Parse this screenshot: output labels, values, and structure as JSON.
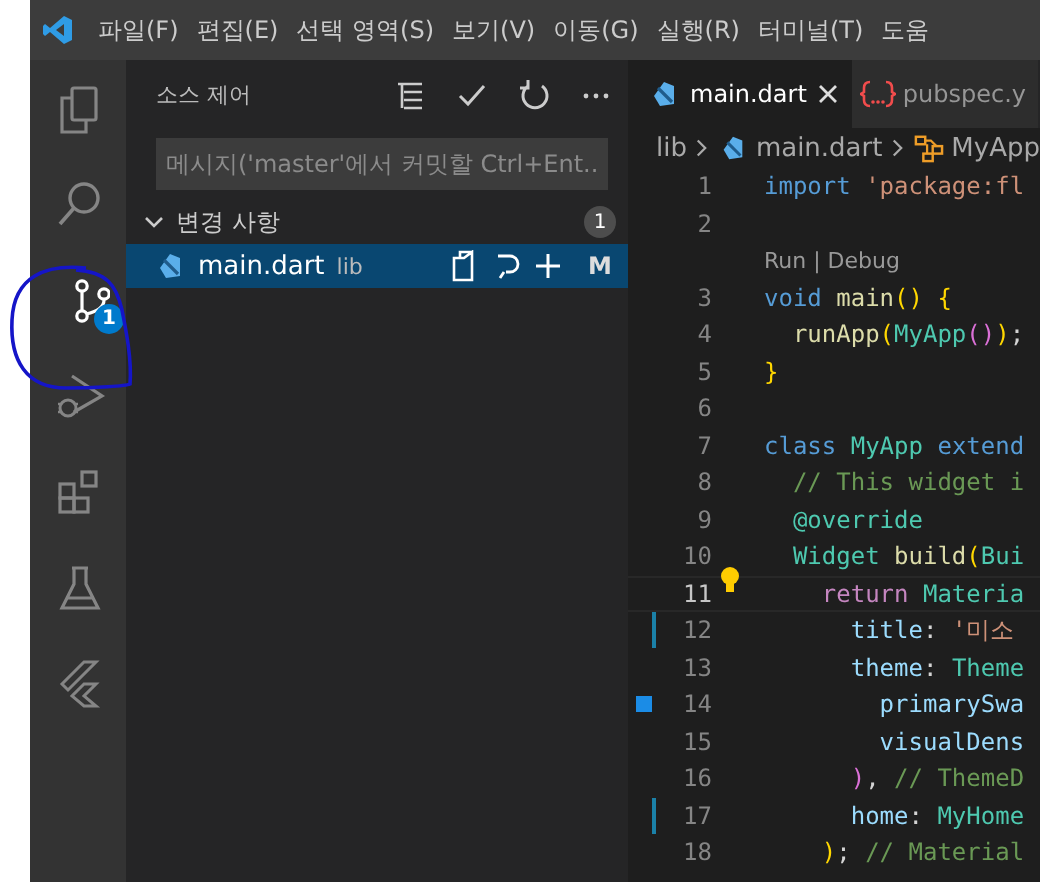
{
  "menu_bar": {
    "items": [
      "파일(F)",
      "편집(E)",
      "선택 영역(S)",
      "보기(V)",
      "이동(G)",
      "실행(R)",
      "터미널(T)",
      "도움"
    ]
  },
  "activity_bar": [
    {
      "kind": "explorer",
      "selected": false
    },
    {
      "kind": "search",
      "selected": false
    },
    {
      "kind": "source-control",
      "selected": true,
      "badge": "1"
    },
    {
      "kind": "run",
      "selected": false
    },
    {
      "kind": "extensions",
      "selected": false
    },
    {
      "kind": "testing",
      "selected": false
    },
    {
      "kind": "flutter",
      "selected": false
    }
  ],
  "annotation": {
    "kind": "circle"
  },
  "sidebar": {
    "title": "소스 제어",
    "commit_input": {
      "placeholder": "메시지('master'에서 커밋할 Ctrl+Ent..."
    },
    "section": {
      "title": "변경 사항",
      "expanded": true,
      "count": "1"
    },
    "files": [
      {
        "name": "main.dart",
        "folder": "lib",
        "status": "M",
        "selected": true
      }
    ]
  },
  "tabs": [
    {
      "label": "main.dart",
      "kind": "dart",
      "selected": true
    },
    {
      "label": "pubspec.y",
      "kind": "yaml",
      "selected": false
    }
  ],
  "breadcrumb": [
    {
      "kind": "folder",
      "text": "lib"
    },
    {
      "kind": "dart",
      "text": "main.dart"
    },
    {
      "kind": "class",
      "text": "MyApp"
    }
  ],
  "code": [
    {
      "number": "1",
      "current": false,
      "modified": false,
      "marker": false,
      "tokens": [
        {
          "kind": "kw",
          "text": "import "
        },
        {
          "kind": "str",
          "text": "'package:fl"
        }
      ]
    },
    {
      "number": "2",
      "current": false,
      "modified": false,
      "marker": false
    },
    {
      "kind": "codelens",
      "text": "Run | Debug"
    },
    {
      "number": "3",
      "current": false,
      "modified": false,
      "marker": false,
      "tokens": [
        {
          "kind": "kw",
          "text": "void "
        },
        {
          "kind": "fn",
          "text": "main"
        },
        {
          "kind": "br",
          "text": "() {"
        }
      ]
    },
    {
      "number": "4",
      "current": false,
      "modified": false,
      "marker": false,
      "tokens": [
        {
          "kind": "fn",
          "text": "  runApp"
        },
        {
          "kind": "br",
          "text": "("
        },
        {
          "kind": "ty",
          "text": "MyApp"
        },
        {
          "kind": "br2",
          "text": "()"
        },
        {
          "kind": "br",
          "text": ")"
        },
        {
          "kind": "pl",
          "text": ";"
        }
      ]
    },
    {
      "number": "5",
      "current": false,
      "modified": false,
      "marker": false,
      "tokens": [
        {
          "kind": "br",
          "text": "}"
        }
      ]
    },
    {
      "number": "6",
      "current": false,
      "modified": false,
      "marker": false
    },
    {
      "number": "7",
      "current": false,
      "modified": false,
      "marker": false,
      "tokens": [
        {
          "kind": "kw",
          "text": "class "
        },
        {
          "kind": "ty",
          "text": "MyApp "
        },
        {
          "kind": "kw",
          "text": "extend"
        }
      ]
    },
    {
      "number": "8",
      "current": false,
      "modified": false,
      "marker": false,
      "tokens": [
        {
          "kind": "cm",
          "text": "  // This widget i"
        }
      ]
    },
    {
      "number": "9",
      "current": false,
      "modified": false,
      "marker": false,
      "tokens": [
        {
          "kind": "ty",
          "text": "  @override"
        }
      ]
    },
    {
      "number": "10",
      "current": false,
      "modified": false,
      "marker": false,
      "tokens": [
        {
          "kind": "ty",
          "text": "  Widget "
        },
        {
          "kind": "fn",
          "text": "build"
        },
        {
          "kind": "br",
          "text": "("
        },
        {
          "kind": "ty",
          "text": "Bui"
        }
      ]
    },
    {
      "number": "11",
      "current": true,
      "modified": false,
      "marker": false,
      "tokens": [
        {
          "kind": "ctl",
          "text": "    return "
        },
        {
          "kind": "ty",
          "text": "Materia"
        }
      ]
    },
    {
      "number": "12",
      "current": false,
      "modified": true,
      "marker": false,
      "tokens": [
        {
          "kind": "vr",
          "text": "      title"
        },
        {
          "kind": "pl",
          "text": ": "
        },
        {
          "kind": "str",
          "text": "'미소"
        }
      ]
    },
    {
      "number": "13",
      "current": false,
      "modified": false,
      "marker": false,
      "tokens": [
        {
          "kind": "vr",
          "text": "      theme"
        },
        {
          "kind": "pl",
          "text": ": "
        },
        {
          "kind": "ty",
          "text": "Theme"
        }
      ]
    },
    {
      "number": "14",
      "current": false,
      "modified": false,
      "marker": true,
      "tokens": [
        {
          "kind": "vr",
          "text": "        primarySwa"
        }
      ]
    },
    {
      "number": "15",
      "current": false,
      "modified": false,
      "marker": false,
      "tokens": [
        {
          "kind": "vr",
          "text": "        visualDens"
        }
      ]
    },
    {
      "number": "16",
      "current": false,
      "modified": false,
      "marker": false,
      "tokens": [
        {
          "kind": "br2",
          "text": "      )"
        },
        {
          "kind": "pl",
          "text": ", "
        },
        {
          "kind": "cm",
          "text": "// ThemeD"
        }
      ]
    },
    {
      "number": "17",
      "current": false,
      "modified": true,
      "marker": false,
      "tokens": [
        {
          "kind": "vr",
          "text": "      home"
        },
        {
          "kind": "pl",
          "text": ": "
        },
        {
          "kind": "ty",
          "text": "MyHome"
        }
      ]
    },
    {
      "number": "18",
      "current": false,
      "modified": false,
      "marker": false,
      "tokens": [
        {
          "kind": "br",
          "text": "    )"
        },
        {
          "kind": "pl",
          "text": "; "
        },
        {
          "kind": "cm",
          "text": "// Material"
        }
      ]
    }
  ]
}
